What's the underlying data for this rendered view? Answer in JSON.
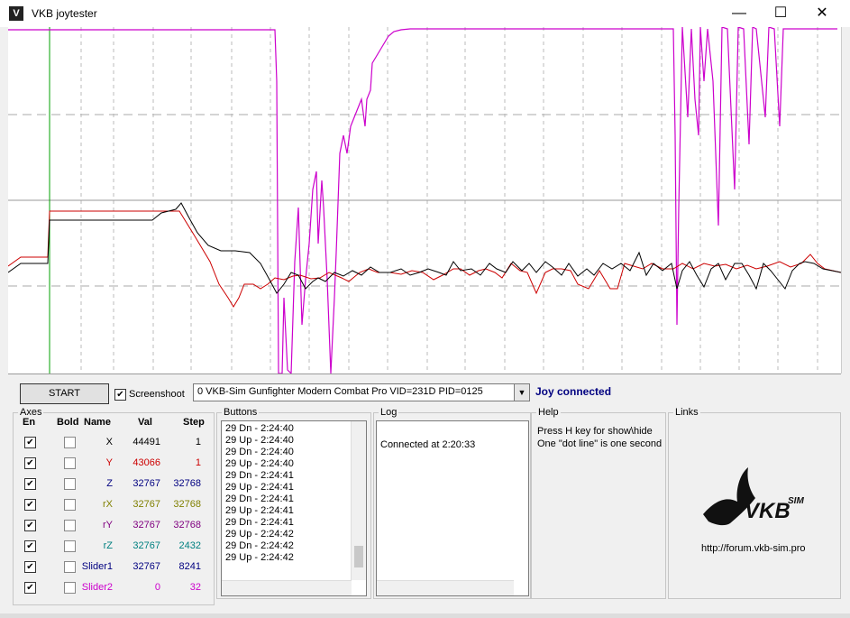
{
  "window": {
    "title": "VKB joytester",
    "app_icon": "V"
  },
  "window_buttons": {
    "minimize": "—",
    "maximize": "☐",
    "close": "✕"
  },
  "colors": {
    "x_trace": "#000000",
    "y_trace": "#cc0000",
    "slider2_trace": "#cc00cc",
    "cursor": "#00a000",
    "status": "#000080"
  },
  "toolbar": {
    "start_label": "START",
    "screenshot_label": "Screenshoot",
    "screenshot_checked": "✔",
    "device_value": "0  VKB-Sim Gunfighter Modern Combat Pro  VID=231D PID=0125",
    "status": "Joy connected"
  },
  "axes": {
    "title": "Axes",
    "headers": {
      "en": "En",
      "bold": "Bold",
      "name": "Name",
      "val": "Val",
      "step": "Step"
    },
    "rows": [
      {
        "en": "✔",
        "name": "X",
        "val": "44491",
        "step": "1",
        "color": "#000000"
      },
      {
        "en": "✔",
        "name": "Y",
        "val": "43066",
        "step": "1",
        "color": "#cc0000"
      },
      {
        "en": "✔",
        "name": "Z",
        "val": "32767",
        "step": "32768",
        "color": "#000080"
      },
      {
        "en": "✔",
        "name": "rX",
        "val": "32767",
        "step": "32768",
        "color": "#808000"
      },
      {
        "en": "✔",
        "name": "rY",
        "val": "32767",
        "step": "32768",
        "color": "#800080"
      },
      {
        "en": "✔",
        "name": "rZ",
        "val": "32767",
        "step": "2432",
        "color": "#008080"
      },
      {
        "en": "✔",
        "name": "Slider1",
        "val": "32767",
        "step": "8241",
        "color": "#000080"
      },
      {
        "en": "✔",
        "name": "Slider2",
        "val": "0",
        "step": "32",
        "color": "#cc00cc"
      }
    ]
  },
  "buttons_panel": {
    "title": "Buttons",
    "entries": [
      "29 Dn - 2:24:40",
      "29 Up - 2:24:40",
      "29 Dn - 2:24:40",
      "29 Up - 2:24:40",
      "29 Dn - 2:24:41",
      "29 Up - 2:24:41",
      "29 Dn - 2:24:41",
      "29 Up - 2:24:41",
      "29 Dn - 2:24:41",
      "29 Up - 2:24:42",
      "29 Dn - 2:24:42",
      "29 Up - 2:24:42"
    ]
  },
  "log_panel": {
    "title": "Log",
    "text": "Connected at 2:20:33"
  },
  "help_panel": {
    "title": "Help",
    "line1": "Press H key for show\\hide",
    "line2": "One \"dot line\" is one second"
  },
  "links_panel": {
    "title": "Links",
    "logo_text": "VKB",
    "logo_sup": "SIM",
    "url": "http://forum.vkb-sim.pro"
  }
}
